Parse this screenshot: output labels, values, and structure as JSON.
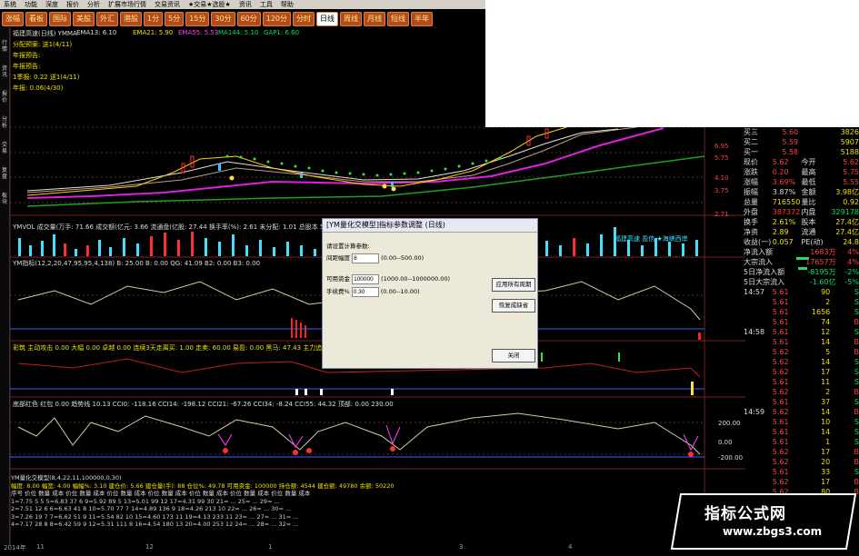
{
  "menu": [
    "系统",
    "功能",
    "深度",
    "报价",
    "分析",
    "扩展市场行情",
    "交易资讯",
    "★交易★选股★",
    "资讯",
    "工具",
    "帮助"
  ],
  "toolbar": {
    "buttons": [
      "涨幅",
      "看板",
      "国际",
      "美股",
      "外汇",
      "港股",
      "1分",
      "5分",
      "15分",
      "30分",
      "60分",
      "120分",
      "分时",
      "日线",
      "周线",
      "月线",
      "短线",
      "半年"
    ],
    "active": "日线"
  },
  "left_nav": [
    "行情",
    "资讯",
    "报价",
    "分析",
    "交易",
    "复盘",
    "板块"
  ],
  "price_panel": {
    "title": "福建高速(日线) YMMA",
    "ma": [
      "EMA13: 6.10",
      "EMA21: 5.90",
      "EMA55: 5.53",
      "MA144: 5.10",
      "GAP1: 6.60"
    ],
    "info": [
      "分配预案: 送1(4/11)",
      "年报预告:",
      "年报预告:",
      "1季报: 0.22 送1(4/11)",
      "年报: 0.06(4/30)"
    ],
    "right_ticks": [
      "6.95",
      "5.75",
      "4.10",
      "3.75",
      "2.71"
    ]
  },
  "vol_panel": {
    "title": "YMVOL 成交量(万手: 71.66 成交额(亿元: 3.66 流通盘(亿股: 27.44 换手率(%): 2.61 未分配: 1.01 总股本 5.8",
    "legend": "福建高速 盈信 ★海峡西岸"
  },
  "ind1": {
    "title": "YM指标(12,2,20,47,95,95,4,138) B: 25.00 B: 0.00 QG: 41.09 B2: 0.00 B3: 0.00"
  },
  "ind2": {
    "title": "彩筑 主动攻击 0.00 大幅 0.00 卓越 0.00 连续3天走离买: 1.00 走卖: 60.00 易盈: 0.00 黑马: 47.43 主力追击: 0.00"
  },
  "ind3": {
    "title": "底部红色 红包 0.00 趋势线 10.13 CCI0: -118.16 CCI14: -198.12 CCI21: -67.26 CCI34: -8.24 CCI55: 44.32 顶部: 0.00 230.00"
  },
  "ind3_ticks": [
    "200.00",
    "0.00",
    "-200.00"
  ],
  "bottom_panel": {
    "title": "YM量化交模型(8,4,22,11,100000,0,30)",
    "summary": "幅度: 8.00 幅宽: 4.00 幅幅%: 3.10 建仓价: 5.66 建仓量(手): 88 仓位%: 49.78 可用资金: 100000 持仓额: 4544 建仓额: 49780 余额: 50220",
    "rows": [
      "序号 价位 数量 成本   价位 数量 成本   价位 数量 成本   价位 数量 成本   价位 数量 成本   价位 数量 成本   价位 数量 成本",
      "1=7.75  5  5     5=6.83  37  6     9=5.92  89  5     13=5.01  99  12    17=4.31  99  30    21=   ...   25=   ...   29=   ...",
      "2=7.51 12  6     6=6.63  41  8     10=5.70  77  7    14=4.89  136  9    18=4.26  213  10   22=   ...   26=   ...   30=   ...",
      "3=7.26 19  7     7=6.62  51  9     11=5.54  82  10   15=4.60  173  11   19=4.13  233  11   23=   ...   27=   ...   31=   ...",
      "4=7.17 28  8     8=6.42  59  9     12=5.31  111  8   16=4.54  180  13   20=4.00  253  12   24=   ...   28=   ...   32=   ..."
    ]
  },
  "quote": [
    {
      "l": "买三",
      "v": "5.60",
      "r": "3826"
    },
    {
      "l": "买二",
      "v": "5.59",
      "r": "5907"
    },
    {
      "l": "买一",
      "v": "5.58",
      "r": "5188"
    },
    {
      "l": "现价",
      "v": "5.62",
      "r2l": "今开",
      "r": "5.62"
    },
    {
      "l": "涨跌",
      "v": "0.20",
      "r2l": "最高",
      "r": "5.75"
    },
    {
      "l": "涨幅",
      "v": "3.69%",
      "r2l": "最低",
      "r": "5.55"
    },
    {
      "l": "振幅",
      "v": "3.87%",
      "r2l": "金额",
      "r": "3.98亿"
    },
    {
      "l": "总量",
      "v": "716550",
      "r2l": "量比",
      "r": "0.92"
    },
    {
      "l": "外盘",
      "v": "387372",
      "r2l": "内盘",
      "r": "329178"
    },
    {
      "l": "换手",
      "v": "2.61%",
      "r2l": "股本",
      "r": "27.4亿"
    },
    {
      "l": "净资",
      "v": "2.89",
      "r2l": "流通",
      "r": "27.4亿"
    },
    {
      "l": "收益(一)",
      "v": "0.057",
      "r2l": "PE(动)",
      "r": "24.8"
    }
  ],
  "flow": [
    {
      "l": "净流入额",
      "v": "1683万",
      "p": "4%"
    },
    {
      "l": "大宗流入",
      "v": "17657万",
      "p": "4%"
    },
    {
      "l": "5日净流入额",
      "v": "-8195万",
      "p": "-2%"
    },
    {
      "l": "5日大宗流入",
      "v": "-1.60亿",
      "p": "-5%"
    }
  ],
  "ticks": [
    {
      "t": "14:57",
      "p": "5.61",
      "v": "90",
      "d": "S"
    },
    {
      "t": "",
      "p": "5.61",
      "v": "2",
      "d": "S"
    },
    {
      "t": "",
      "p": "5.61",
      "v": "1656",
      "d": "S"
    },
    {
      "t": "",
      "p": "5.61",
      "v": "74",
      "d": "B"
    },
    {
      "t": "14:58",
      "p": "5.61",
      "v": "12",
      "d": "S"
    },
    {
      "t": "",
      "p": "5.61",
      "v": "14",
      "d": "B"
    },
    {
      "t": "",
      "p": "5.62",
      "v": "5",
      "d": "B"
    },
    {
      "t": "",
      "p": "5.62",
      "v": "14",
      "d": "S"
    },
    {
      "t": "",
      "p": "5.62",
      "v": "17",
      "d": "S"
    },
    {
      "t": "",
      "p": "5.61",
      "v": "11",
      "d": "S"
    },
    {
      "t": "",
      "p": "5.62",
      "v": "2",
      "d": "B"
    },
    {
      "t": "",
      "p": "5.61",
      "v": "37",
      "d": "S"
    },
    {
      "t": "14:59",
      "p": "5.62",
      "v": "14",
      "d": "B"
    },
    {
      "t": "",
      "p": "5.61",
      "v": "10",
      "d": "S"
    },
    {
      "t": "",
      "p": "5.61",
      "v": "14",
      "d": "S"
    },
    {
      "t": "",
      "p": "5.61",
      "v": "1",
      "d": "S"
    },
    {
      "t": "",
      "p": "5.62",
      "v": "17",
      "d": "B"
    },
    {
      "t": "",
      "p": "5.62",
      "v": "20",
      "d": "B"
    },
    {
      "t": "",
      "p": "5.61",
      "v": "33",
      "d": "S"
    },
    {
      "t": "",
      "p": "5.62",
      "v": "17",
      "d": "B"
    },
    {
      "t": "",
      "p": "5.62",
      "v": "80",
      "d": "B"
    }
  ],
  "dialog": {
    "title": "[YM量化交模型]指标参数调整 (日线)",
    "prompt": "请设置计算参数:",
    "p1_label": "间距幅度",
    "p1_value": "8",
    "p1_range": "(0.00--500.00)",
    "p2_label": "可用资金",
    "p2_value": "100000",
    "p2_range": "(1000.00--1000000.00)",
    "p3_label": "手续费%",
    "p3_value": "0.30",
    "p3_range": "(0.00--10.00)",
    "btn_apply": "应用所有周期",
    "btn_restore": "恢复成缺省",
    "btn_close": "关闭"
  },
  "status": {
    "year": "2014年",
    "m1": "11",
    "m2": "12",
    "m3": "1",
    "m4": "3",
    "m5": "4"
  },
  "watermark": {
    "title": "指标公式网",
    "url": "www.zbgs3.com"
  }
}
